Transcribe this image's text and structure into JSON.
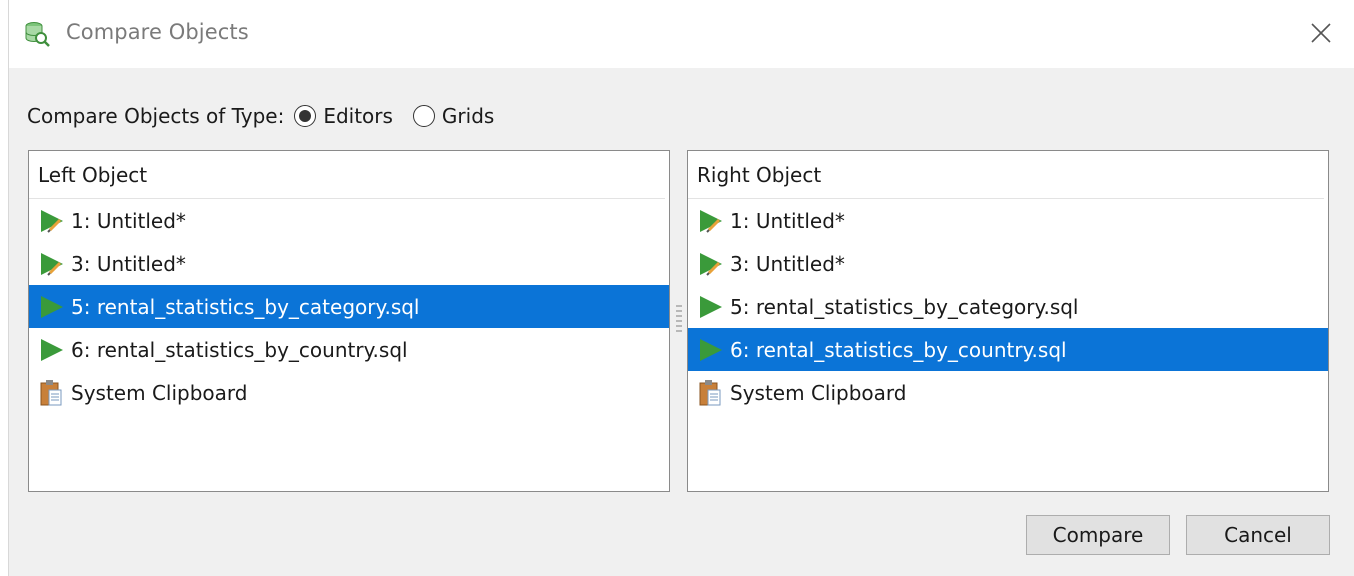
{
  "window": {
    "title": "Compare Objects",
    "icon": "database-compare-icon"
  },
  "type_selector": {
    "label": "Compare Objects of Type:",
    "options": [
      {
        "label": "Editors",
        "selected": true
      },
      {
        "label": "Grids",
        "selected": false
      }
    ]
  },
  "left_panel": {
    "header": "Left Object",
    "items": [
      {
        "label": "1: Untitled*",
        "icon": "edit-run-icon",
        "selected": false
      },
      {
        "label": "3: Untitled*",
        "icon": "edit-run-icon",
        "selected": false
      },
      {
        "label": "5: rental_statistics_by_category.sql",
        "icon": "run-icon",
        "selected": true
      },
      {
        "label": "6: rental_statistics_by_country.sql",
        "icon": "run-icon",
        "selected": false
      },
      {
        "label": "System Clipboard",
        "icon": "clipboard-icon",
        "selected": false
      }
    ]
  },
  "right_panel": {
    "header": "Right Object",
    "items": [
      {
        "label": "1: Untitled*",
        "icon": "edit-run-icon",
        "selected": false
      },
      {
        "label": "3: Untitled*",
        "icon": "edit-run-icon",
        "selected": false
      },
      {
        "label": "5: rental_statistics_by_category.sql",
        "icon": "run-icon",
        "selected": false
      },
      {
        "label": "6: rental_statistics_by_country.sql",
        "icon": "run-icon",
        "selected": true
      },
      {
        "label": "System Clipboard",
        "icon": "clipboard-icon",
        "selected": false
      }
    ]
  },
  "buttons": {
    "compare": "Compare",
    "cancel": "Cancel"
  },
  "colors": {
    "selection": "#0b74d7",
    "run_green": "#3a9a3a",
    "pencil_orange": "#e8a23a"
  }
}
